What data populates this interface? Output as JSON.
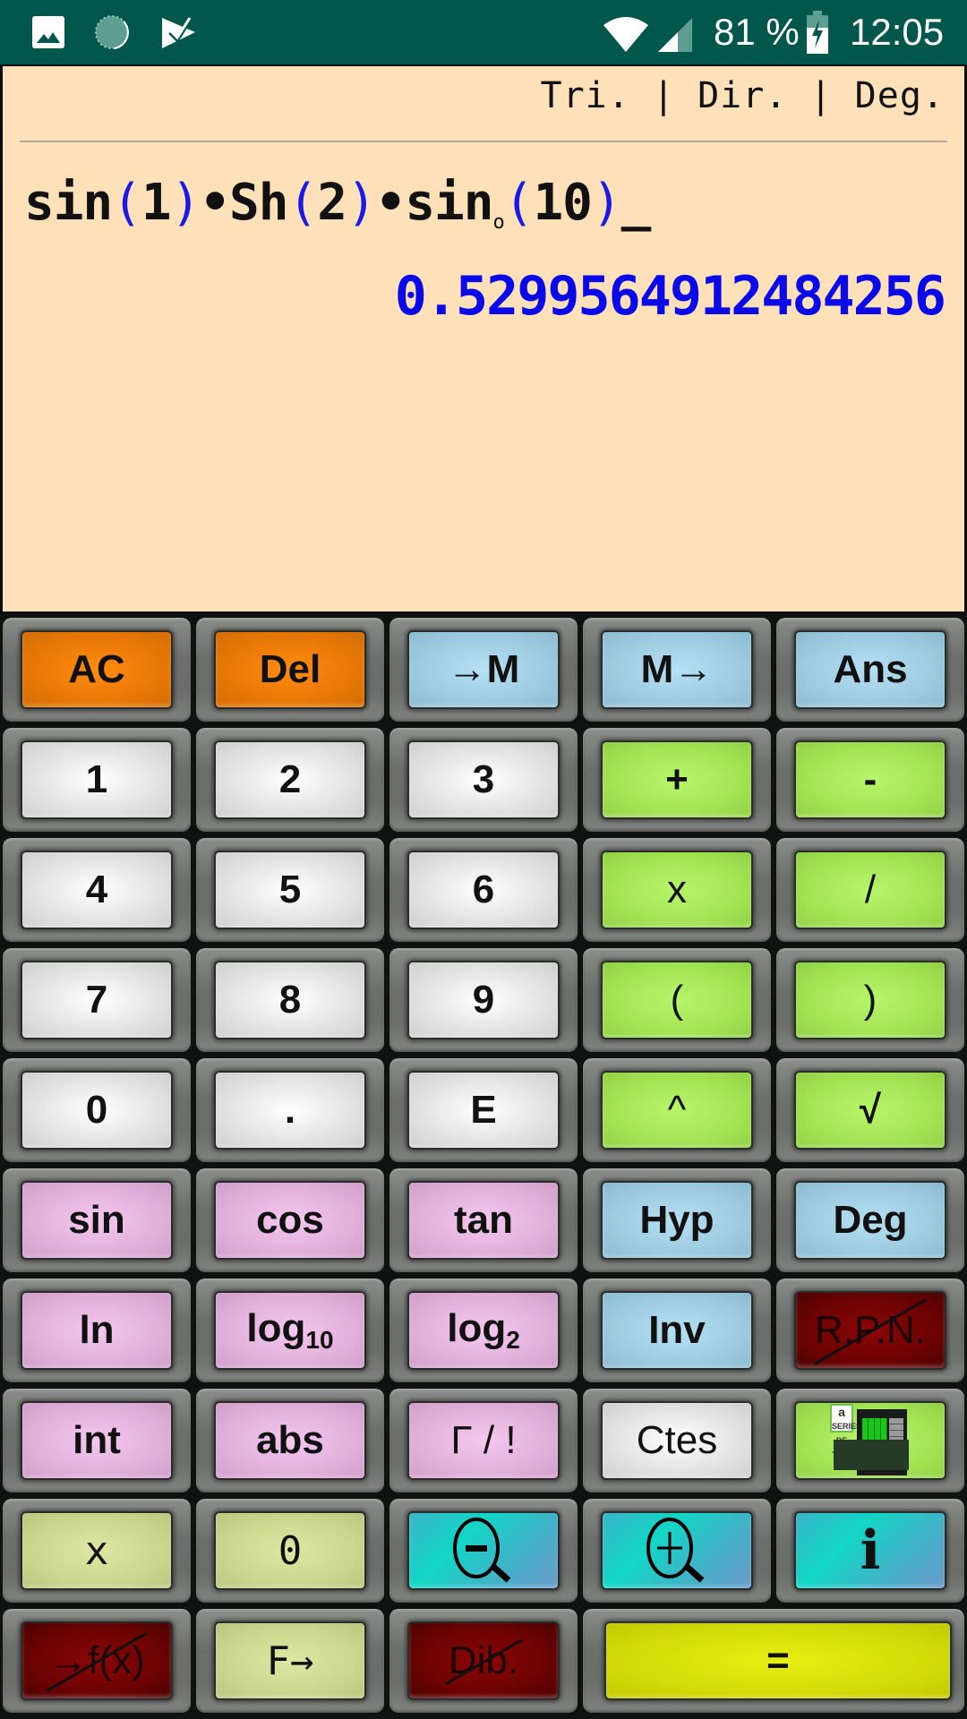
{
  "status_bar": {
    "left_icons": [
      "gallery-icon",
      "sync-icon",
      "play-store-icon"
    ],
    "right_icons": [
      "wifi-icon",
      "signal-icon",
      "battery-charging-icon"
    ],
    "battery_percent": "81 %",
    "time": "12:05"
  },
  "display": {
    "mode": "Tri. | Dir. | Deg.",
    "expression": {
      "parts": [
        {
          "t": "sin",
          "k": "fn"
        },
        {
          "t": "(",
          "k": "p"
        },
        {
          "t": "1",
          "k": "fn"
        },
        {
          "t": ")",
          "k": "p"
        },
        {
          "t": "•Sh",
          "k": "fn"
        },
        {
          "t": "(",
          "k": "p"
        },
        {
          "t": "2",
          "k": "fn"
        },
        {
          "t": ")",
          "k": "p"
        },
        {
          "t": "•sin",
          "k": "fn"
        },
        {
          "t": "o",
          "k": "sub"
        },
        {
          "t": "(",
          "k": "p"
        },
        {
          "t": "10",
          "k": "fn"
        },
        {
          "t": ")",
          "k": "p"
        },
        {
          "t": "_",
          "k": "fn"
        }
      ]
    },
    "result": "0.5299564912484256"
  },
  "keypad": {
    "rows": [
      [
        {
          "label": "AC",
          "color": "orange",
          "name": "all-clear-button"
        },
        {
          "label": "Del",
          "color": "orange",
          "name": "delete-button"
        },
        {
          "label": "→M",
          "color": "blue",
          "name": "store-memory-button"
        },
        {
          "label": "M→",
          "color": "blue",
          "name": "recall-memory-button"
        },
        {
          "label": "Ans",
          "color": "blue",
          "name": "answer-button"
        }
      ],
      [
        {
          "label": "1",
          "color": "white",
          "name": "digit-1-button"
        },
        {
          "label": "2",
          "color": "white",
          "name": "digit-2-button"
        },
        {
          "label": "3",
          "color": "white",
          "name": "digit-3-button"
        },
        {
          "label": "+",
          "color": "green",
          "name": "add-button"
        },
        {
          "label": "-",
          "color": "green",
          "name": "subtract-button"
        }
      ],
      [
        {
          "label": "4",
          "color": "white",
          "name": "digit-4-button"
        },
        {
          "label": "5",
          "color": "white",
          "name": "digit-5-button"
        },
        {
          "label": "6",
          "color": "white",
          "name": "digit-6-button"
        },
        {
          "label": "x",
          "color": "green",
          "name": "multiply-button",
          "style": "thin"
        },
        {
          "label": "/",
          "color": "green",
          "name": "divide-button",
          "style": "thin"
        }
      ],
      [
        {
          "label": "7",
          "color": "white",
          "name": "digit-7-button"
        },
        {
          "label": "8",
          "color": "white",
          "name": "digit-8-button"
        },
        {
          "label": "9",
          "color": "white",
          "name": "digit-9-button"
        },
        {
          "label": "(",
          "color": "green",
          "name": "open-paren-button",
          "style": "thin"
        },
        {
          "label": ")",
          "color": "green",
          "name": "close-paren-button",
          "style": "thin"
        }
      ],
      [
        {
          "label": "0",
          "color": "white",
          "name": "digit-0-button"
        },
        {
          "label": ".",
          "color": "white",
          "name": "decimal-point-button"
        },
        {
          "label": "E",
          "color": "white",
          "name": "exponent-button"
        },
        {
          "label": "^",
          "color": "green",
          "name": "power-button",
          "style": "thin"
        },
        {
          "label": "√",
          "color": "green",
          "name": "sqrt-button"
        }
      ],
      [
        {
          "label": "sin",
          "color": "pink",
          "name": "sin-button"
        },
        {
          "label": "cos",
          "color": "pink",
          "name": "cos-button"
        },
        {
          "label": "tan",
          "color": "pink",
          "name": "tan-button"
        },
        {
          "label": "Hyp",
          "color": "blue",
          "name": "hyperbolic-button"
        },
        {
          "label": "Deg",
          "color": "blue",
          "name": "degrees-button"
        }
      ],
      [
        {
          "label": "ln",
          "color": "pink",
          "name": "ln-button"
        },
        {
          "label": "log",
          "sub": "10",
          "color": "pink",
          "name": "log10-button"
        },
        {
          "label": "log",
          "sub": "2",
          "color": "pink",
          "name": "log2-button"
        },
        {
          "label": "Inv",
          "color": "blue",
          "name": "inverse-button"
        },
        {
          "label": "R.P.N.",
          "color": "red",
          "name": "rpn-button",
          "style": "strike"
        }
      ],
      [
        {
          "label": "int",
          "color": "pink",
          "name": "integer-button"
        },
        {
          "label": "abs",
          "color": "pink",
          "name": "absolute-button"
        },
        {
          "label": "Γ / !",
          "color": "pink",
          "name": "gamma-factorial-button",
          "style": "thin"
        },
        {
          "label": "Ctes",
          "color": "white",
          "name": "constants-button",
          "style": "thin"
        },
        {
          "label": "SERIES DE TAYLOR",
          "color": "green",
          "name": "taylor-series-app-button",
          "style": "taylor"
        }
      ],
      [
        {
          "label": "x",
          "color": "olive",
          "name": "variable-x-button",
          "style": "mono"
        },
        {
          "label": "0",
          "color": "olive",
          "name": "zero-function-button",
          "style": "mono"
        },
        {
          "label": "",
          "color": "cyan",
          "name": "zoom-out-button",
          "icon": "zoom-out-icon"
        },
        {
          "label": "",
          "color": "cyan",
          "name": "zoom-in-button",
          "icon": "zoom-in-icon"
        },
        {
          "label": "i",
          "color": "cyan",
          "name": "info-button",
          "style": "serif"
        }
      ],
      [
        {
          "label": "→f(x)",
          "color": "red",
          "name": "to-function-button",
          "style": "strike"
        },
        {
          "label": "F→",
          "color": "olive",
          "name": "function-recall-button",
          "style": "mono"
        },
        {
          "label": "Dib.",
          "color": "red",
          "name": "draw-button",
          "style": "strike"
        },
        {
          "label": "=",
          "color": "yellow",
          "name": "equals-button",
          "span": 2
        }
      ]
    ]
  }
}
